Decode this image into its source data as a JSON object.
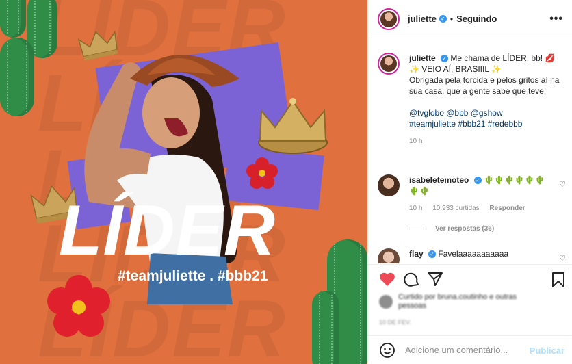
{
  "image": {
    "bg_word": "LÍDER",
    "title": "LÍDER",
    "hashtags": "#teamjuliette . #bbb21",
    "colors": {
      "background": "#e0703e",
      "accent": "#7b63d6"
    }
  },
  "header": {
    "username": "juliette",
    "follow_status": "Seguindo",
    "more_icon": "more-horizontal-icon"
  },
  "caption": {
    "username": "juliette",
    "text_line1": "Me chama de LÍDER, bb!",
    "text_line2": "VEIO AÍ, BRASIIIL",
    "text_line3": "Obrigada pela torcida e pelos gritos aí na sua casa, que a gente sabe que teve!",
    "mentions": "@tvglobo @bbb @gshow",
    "tags": "#teamjuliette #bbb21 #redebbb",
    "time": "10 h"
  },
  "comments": [
    {
      "username": "isabeletemoteo",
      "text": "🌵🌵🌵🌵🌵🌵🌵🌵",
      "time": "10 h",
      "likes": "10.933 curtidas",
      "reply": "Responder",
      "view_replies": "Ver respostas (36)"
    },
    {
      "username": "flay",
      "text": "Favelaaaaaaaaaaa"
    }
  ],
  "actions": {
    "like": "heart-icon",
    "comment": "comment-icon",
    "share": "share-icon",
    "save": "bookmark-icon"
  },
  "likes_text": "Curtido por bruna.coutinho e outras pessoas",
  "date_stamp": "10 DE FEV.",
  "add_comment": {
    "placeholder": "Adicione um comentário...",
    "publish": "Publicar"
  }
}
